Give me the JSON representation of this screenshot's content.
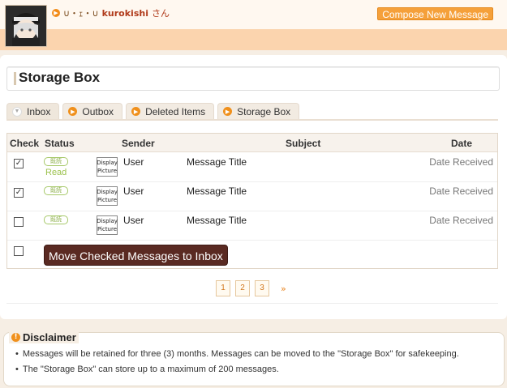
{
  "header": {
    "kaomoji": "∪・ｪ・∪",
    "username": "kurokishi",
    "honorific": "さん",
    "compose_label": "Compose New Message"
  },
  "page_title": "Storage Box",
  "tabs": [
    {
      "label": "Inbox",
      "active": true
    },
    {
      "label": "Outbox",
      "active": false
    },
    {
      "label": "Deleted Items",
      "active": false
    },
    {
      "label": "Storage Box",
      "active": false
    }
  ],
  "table": {
    "headers": {
      "check": "Check",
      "status": "Status",
      "sender": "Sender",
      "subject": "Subject",
      "date": "Date"
    },
    "rows": [
      {
        "checked": true,
        "badge": "既読",
        "status": "Read",
        "dp": "Display Picture",
        "sender": "User",
        "subject": "Message Title",
        "date": "Date Received"
      },
      {
        "checked": true,
        "badge": "既読",
        "status": "",
        "dp": "Display Picture",
        "sender": "User",
        "subject": "Message Title",
        "date": "Date Received"
      },
      {
        "checked": false,
        "badge": "既読",
        "status": "",
        "dp": "Display Picture",
        "sender": "User",
        "subject": "Message Title",
        "date": "Date Received"
      }
    ],
    "move_label": "Move Checked Messages to Inbox"
  },
  "pagination": {
    "pages": [
      "1",
      "2",
      "3"
    ],
    "next": "»"
  },
  "disclaimer": {
    "title": "Disclaimer",
    "items": [
      "Messages will be retained for three (3) months. Messages can be moved to the \"Storage Box\" for safekeeping.",
      "The \"Storage Box\" can store up to a maximum of 200 messages."
    ]
  },
  "colors": {
    "accent": "#f28c1a",
    "header_bg": "#fbd4ae",
    "move_button": "#5a2a22",
    "read_green": "#9cc24e"
  }
}
